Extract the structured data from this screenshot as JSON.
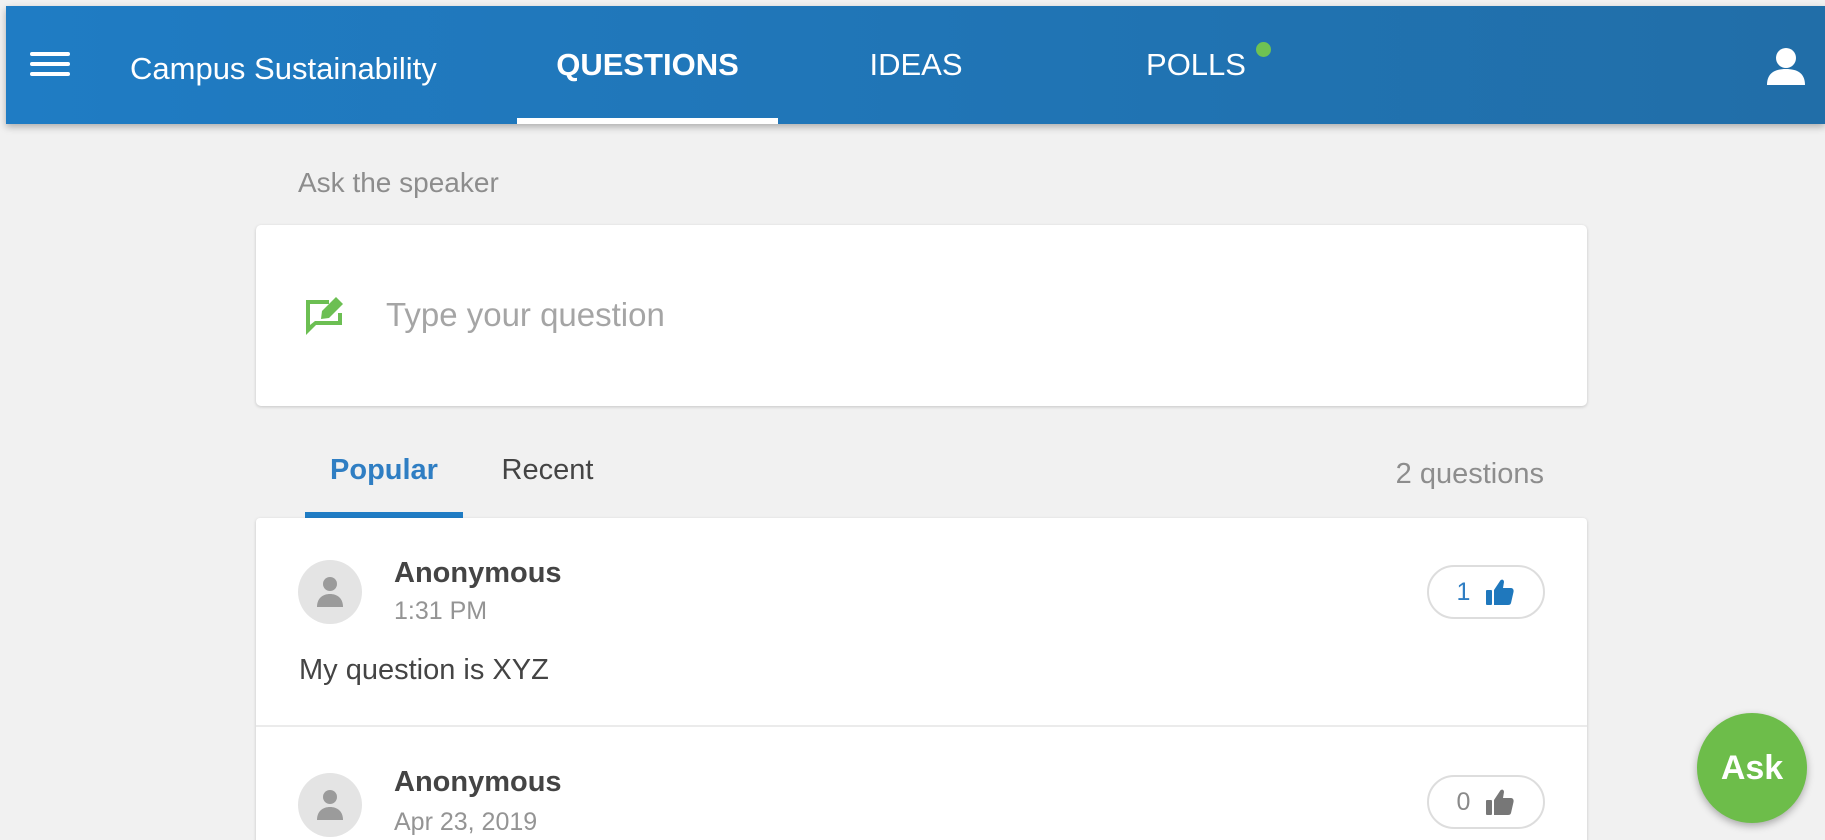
{
  "header": {
    "event_title": "Campus Sustainability",
    "tabs": [
      {
        "label": "QUESTIONS",
        "active": true
      },
      {
        "label": "IDEAS",
        "active": false
      },
      {
        "label": "POLLS",
        "active": false,
        "has_update_dot": true
      }
    ],
    "icons": {
      "menu": "hamburger-menu-icon",
      "profile": "person-icon"
    }
  },
  "ask_section": {
    "label": "Ask the speaker",
    "placeholder": "Type your question",
    "icon": "edit-comment-icon"
  },
  "sort_tabs": [
    {
      "label": "Popular",
      "active": true
    },
    {
      "label": "Recent",
      "active": false
    }
  ],
  "questions_summary": {
    "count_label": "2 questions"
  },
  "questions": [
    {
      "author": "Anonymous",
      "time": "1:31 PM",
      "text": "My question is XYZ",
      "votes": "1",
      "voted": true
    },
    {
      "author": "Anonymous",
      "time": "Apr 23, 2019",
      "text": "",
      "votes": "0",
      "voted": false
    }
  ],
  "fab": {
    "label": "Ask"
  },
  "colors": {
    "primary": "#1f7cc4",
    "accent_green": "#6dbd4a",
    "text_muted": "#8d8d8d",
    "background": "#f1f1f1"
  }
}
